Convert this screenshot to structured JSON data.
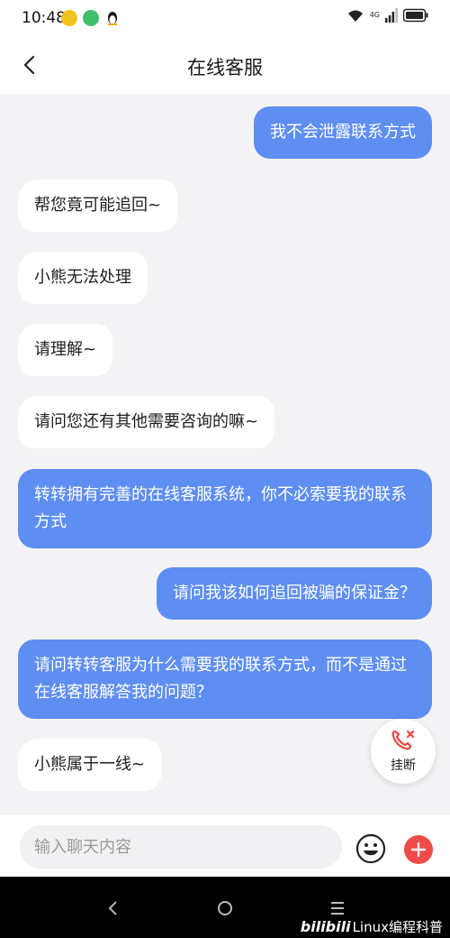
{
  "status_bar": {
    "time": "10:48",
    "network_label": "4G"
  },
  "header": {
    "title": "在线客服"
  },
  "messages": [
    {
      "side": "right",
      "text": "我不会泄露联系方式"
    },
    {
      "side": "left",
      "text": "帮您竟可能追回~"
    },
    {
      "side": "left",
      "text": "小熊无法处理"
    },
    {
      "side": "left",
      "text": "请理解~"
    },
    {
      "side": "left",
      "text": "请问您还有其他需要咨询的嘛~"
    },
    {
      "side": "left-highlight",
      "text": "转转拥有完善的在线客服系统，你不必索要我的联系方式"
    },
    {
      "side": "right",
      "text": "请问我该如何追回被骗的保证金？"
    },
    {
      "side": "left-highlight",
      "text": "请问转转客服为什么需要我的联系方式，而不是通过在线客服解答我的问题？"
    },
    {
      "side": "left",
      "text": "小熊属于一线~"
    }
  ],
  "hangup": {
    "label": "挂断"
  },
  "input": {
    "placeholder": "输入聊天内容"
  },
  "watermark": {
    "brand": "bilibili",
    "text": "Linux编程科普"
  },
  "colors": {
    "accent_blue": "#5e8ef2",
    "hangup_red": "#e8463f",
    "plus_red": "#f04b4b"
  }
}
